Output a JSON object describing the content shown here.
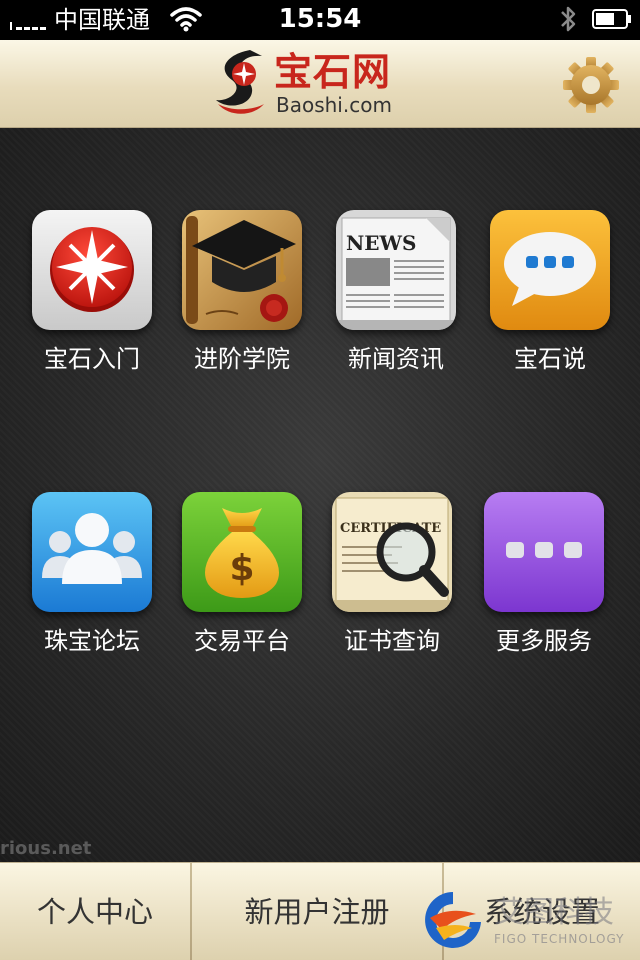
{
  "status_bar": {
    "carrier": "中国联通",
    "time": "15:54"
  },
  "header": {
    "logo_cn": "宝石网",
    "logo_en": "Baoshi.com",
    "settings_icon": "gear-icon"
  },
  "apps": [
    {
      "label": "宝石入门",
      "icon": "compass-star-icon"
    },
    {
      "label": "进阶学院",
      "icon": "graduation-cap-icon"
    },
    {
      "label": "新闻资讯",
      "icon": "newspaper-icon"
    },
    {
      "label": "宝石说",
      "icon": "speech-bubble-icon"
    },
    {
      "label": "珠宝论坛",
      "icon": "users-icon"
    },
    {
      "label": "交易平台",
      "icon": "money-bag-icon"
    },
    {
      "label": "证书查询",
      "icon": "certificate-search-icon"
    },
    {
      "label": "更多服务",
      "icon": "more-dots-icon"
    }
  ],
  "icon_text": {
    "news": "NEWS",
    "certificate": "CERTIFICATE"
  },
  "watermark": "rious.net",
  "tabs": [
    {
      "label": "个人中心"
    },
    {
      "label": "新用户注册"
    },
    {
      "label": "系统设置"
    }
  ],
  "corner_logo": {
    "cn": "艾图科技",
    "en": "FIGO TECHNOLOGY"
  },
  "colors": {
    "brand_red": "#c8261c",
    "header_cream": "#efe6cb",
    "background_dark": "#262626"
  }
}
